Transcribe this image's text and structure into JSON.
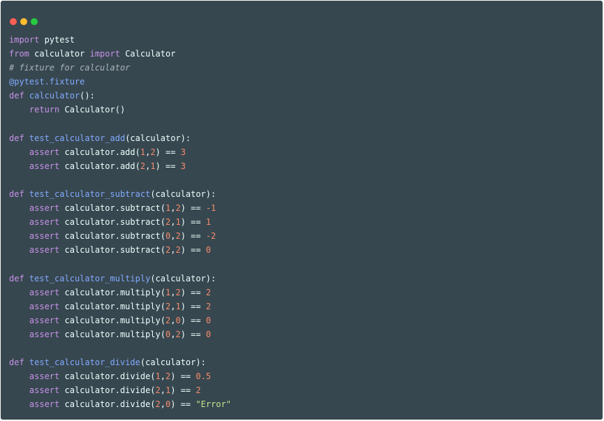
{
  "window_controls": [
    {
      "name": "close",
      "color": "#ff5f56"
    },
    {
      "name": "minimize",
      "color": "#ffbd2e"
    },
    {
      "name": "maximize",
      "color": "#27c93f"
    }
  ],
  "colors": {
    "background": "#37474f",
    "keyword": "#c792ea",
    "function": "#82aaff",
    "number": "#f78c6c",
    "string": "#c3e88d",
    "comment": "#a8b4ba",
    "text": "#eeffff"
  },
  "code_lines": [
    [
      {
        "t": "kw",
        "v": "import"
      },
      {
        "t": "p",
        "v": " pytest"
      }
    ],
    [
      {
        "t": "kw",
        "v": "from"
      },
      {
        "t": "p",
        "v": " calculator "
      },
      {
        "t": "kw",
        "v": "import"
      },
      {
        "t": "p",
        "v": " Calculator"
      }
    ],
    [
      {
        "t": "cm",
        "v": "# fixture for calculator"
      }
    ],
    [
      {
        "t": "dec",
        "v": "@pytest.fixture"
      }
    ],
    [
      {
        "t": "kw",
        "v": "def"
      },
      {
        "t": "p",
        "v": " "
      },
      {
        "t": "fn",
        "v": "calculator"
      },
      {
        "t": "p",
        "v": "():"
      }
    ],
    [
      {
        "t": "p",
        "v": "    "
      },
      {
        "t": "kw",
        "v": "return"
      },
      {
        "t": "p",
        "v": " Calculator()"
      }
    ],
    [],
    [
      {
        "t": "kw",
        "v": "def"
      },
      {
        "t": "p",
        "v": " "
      },
      {
        "t": "fn",
        "v": "test_calculator_add"
      },
      {
        "t": "p",
        "v": "(calculator):"
      }
    ],
    [
      {
        "t": "p",
        "v": "    "
      },
      {
        "t": "kw",
        "v": "assert"
      },
      {
        "t": "p",
        "v": " calculator.add("
      },
      {
        "t": "num",
        "v": "1"
      },
      {
        "t": "p",
        "v": ","
      },
      {
        "t": "num",
        "v": "2"
      },
      {
        "t": "p",
        "v": ") == "
      },
      {
        "t": "num",
        "v": "3"
      }
    ],
    [
      {
        "t": "p",
        "v": "    "
      },
      {
        "t": "kw",
        "v": "assert"
      },
      {
        "t": "p",
        "v": " calculator.add("
      },
      {
        "t": "num",
        "v": "2"
      },
      {
        "t": "p",
        "v": ","
      },
      {
        "t": "num",
        "v": "1"
      },
      {
        "t": "p",
        "v": ") == "
      },
      {
        "t": "num",
        "v": "3"
      }
    ],
    [],
    [
      {
        "t": "kw",
        "v": "def"
      },
      {
        "t": "p",
        "v": " "
      },
      {
        "t": "fn",
        "v": "test_calculator_subtract"
      },
      {
        "t": "p",
        "v": "(calculator):"
      }
    ],
    [
      {
        "t": "p",
        "v": "    "
      },
      {
        "t": "kw",
        "v": "assert"
      },
      {
        "t": "p",
        "v": " calculator.subtract("
      },
      {
        "t": "num",
        "v": "1"
      },
      {
        "t": "p",
        "v": ","
      },
      {
        "t": "num",
        "v": "2"
      },
      {
        "t": "p",
        "v": ") == "
      },
      {
        "t": "num",
        "v": "-1"
      }
    ],
    [
      {
        "t": "p",
        "v": "    "
      },
      {
        "t": "kw",
        "v": "assert"
      },
      {
        "t": "p",
        "v": " calculator.subtract("
      },
      {
        "t": "num",
        "v": "2"
      },
      {
        "t": "p",
        "v": ","
      },
      {
        "t": "num",
        "v": "1"
      },
      {
        "t": "p",
        "v": ") == "
      },
      {
        "t": "num",
        "v": "1"
      }
    ],
    [
      {
        "t": "p",
        "v": "    "
      },
      {
        "t": "kw",
        "v": "assert"
      },
      {
        "t": "p",
        "v": " calculator.subtract("
      },
      {
        "t": "num",
        "v": "0"
      },
      {
        "t": "p",
        "v": ","
      },
      {
        "t": "num",
        "v": "2"
      },
      {
        "t": "p",
        "v": ") == "
      },
      {
        "t": "num",
        "v": "-2"
      }
    ],
    [
      {
        "t": "p",
        "v": "    "
      },
      {
        "t": "kw",
        "v": "assert"
      },
      {
        "t": "p",
        "v": " calculator.subtract("
      },
      {
        "t": "num",
        "v": "2"
      },
      {
        "t": "p",
        "v": ","
      },
      {
        "t": "num",
        "v": "2"
      },
      {
        "t": "p",
        "v": ") == "
      },
      {
        "t": "num",
        "v": "0"
      }
    ],
    [],
    [
      {
        "t": "kw",
        "v": "def"
      },
      {
        "t": "p",
        "v": " "
      },
      {
        "t": "fn",
        "v": "test_calculator_multiply"
      },
      {
        "t": "p",
        "v": "(calculator):"
      }
    ],
    [
      {
        "t": "p",
        "v": "    "
      },
      {
        "t": "kw",
        "v": "assert"
      },
      {
        "t": "p",
        "v": " calculator.multiply("
      },
      {
        "t": "num",
        "v": "1"
      },
      {
        "t": "p",
        "v": ","
      },
      {
        "t": "num",
        "v": "2"
      },
      {
        "t": "p",
        "v": ") == "
      },
      {
        "t": "num",
        "v": "2"
      }
    ],
    [
      {
        "t": "p",
        "v": "    "
      },
      {
        "t": "kw",
        "v": "assert"
      },
      {
        "t": "p",
        "v": " calculator.multiply("
      },
      {
        "t": "num",
        "v": "2"
      },
      {
        "t": "p",
        "v": ","
      },
      {
        "t": "num",
        "v": "1"
      },
      {
        "t": "p",
        "v": ") == "
      },
      {
        "t": "num",
        "v": "2"
      }
    ],
    [
      {
        "t": "p",
        "v": "    "
      },
      {
        "t": "kw",
        "v": "assert"
      },
      {
        "t": "p",
        "v": " calculator.multiply("
      },
      {
        "t": "num",
        "v": "2"
      },
      {
        "t": "p",
        "v": ","
      },
      {
        "t": "num",
        "v": "0"
      },
      {
        "t": "p",
        "v": ") == "
      },
      {
        "t": "num",
        "v": "0"
      }
    ],
    [
      {
        "t": "p",
        "v": "    "
      },
      {
        "t": "kw",
        "v": "assert"
      },
      {
        "t": "p",
        "v": " calculator.multiply("
      },
      {
        "t": "num",
        "v": "0"
      },
      {
        "t": "p",
        "v": ","
      },
      {
        "t": "num",
        "v": "2"
      },
      {
        "t": "p",
        "v": ") == "
      },
      {
        "t": "num",
        "v": "0"
      }
    ],
    [],
    [
      {
        "t": "kw",
        "v": "def"
      },
      {
        "t": "p",
        "v": " "
      },
      {
        "t": "fn",
        "v": "test_calculator_divide"
      },
      {
        "t": "p",
        "v": "(calculator):"
      }
    ],
    [
      {
        "t": "p",
        "v": "    "
      },
      {
        "t": "kw",
        "v": "assert"
      },
      {
        "t": "p",
        "v": " calculator.divide("
      },
      {
        "t": "num",
        "v": "1"
      },
      {
        "t": "p",
        "v": ","
      },
      {
        "t": "num",
        "v": "2"
      },
      {
        "t": "p",
        "v": ") == "
      },
      {
        "t": "num",
        "v": "0.5"
      }
    ],
    [
      {
        "t": "p",
        "v": "    "
      },
      {
        "t": "kw",
        "v": "assert"
      },
      {
        "t": "p",
        "v": " calculator.divide("
      },
      {
        "t": "num",
        "v": "2"
      },
      {
        "t": "p",
        "v": ","
      },
      {
        "t": "num",
        "v": "1"
      },
      {
        "t": "p",
        "v": ") == "
      },
      {
        "t": "num",
        "v": "2"
      }
    ],
    [
      {
        "t": "p",
        "v": "    "
      },
      {
        "t": "kw",
        "v": "assert"
      },
      {
        "t": "p",
        "v": " calculator.divide("
      },
      {
        "t": "num",
        "v": "2"
      },
      {
        "t": "p",
        "v": ","
      },
      {
        "t": "num",
        "v": "0"
      },
      {
        "t": "p",
        "v": ") == "
      },
      {
        "t": "str",
        "v": "\"Error\""
      }
    ]
  ]
}
